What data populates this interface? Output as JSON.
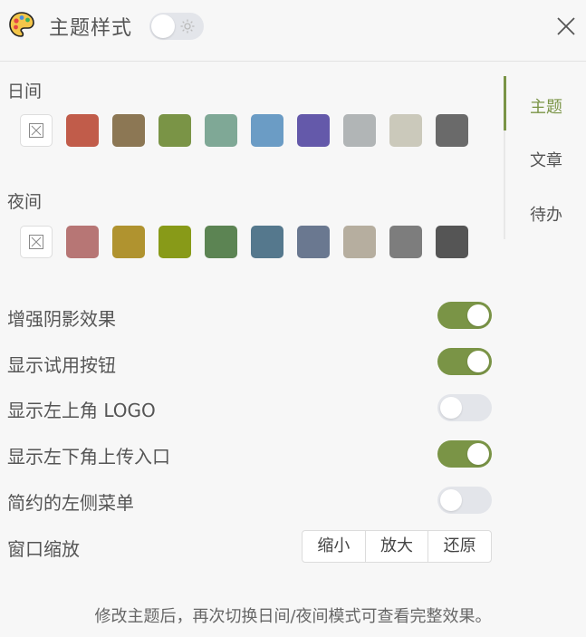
{
  "header": {
    "title": "主题样式",
    "toggle_on": false
  },
  "day": {
    "label": "日间",
    "colors": [
      "#c15c4a",
      "#8c7754",
      "#7a9446",
      "#7fa896",
      "#6b9cc5",
      "#6459aa",
      "#b1b5b6",
      "#cbc9bb",
      "#6a6a6a"
    ]
  },
  "night": {
    "label": "夜间",
    "colors": [
      "#b77675",
      "#b0932f",
      "#889a18",
      "#5c8453",
      "#55788d",
      "#6a7890",
      "#b6ae9f",
      "#7d7d7d",
      "#555555"
    ]
  },
  "side_nav": {
    "items": [
      {
        "label": "主题",
        "active": true
      },
      {
        "label": "文章",
        "active": false
      },
      {
        "label": "待办",
        "active": false
      }
    ]
  },
  "settings": [
    {
      "label": "增强阴影效果",
      "on": true
    },
    {
      "label": "显示试用按钮",
      "on": true
    },
    {
      "label": "显示左上角 LOGO",
      "on": false
    },
    {
      "label": "显示左下角上传入口",
      "on": true
    },
    {
      "label": "简约的左侧菜单",
      "on": false
    }
  ],
  "zoom": {
    "label": "窗口缩放",
    "buttons": [
      "缩小",
      "放大",
      "还原"
    ]
  },
  "footer": "修改主题后，再次切换日间/夜间模式可查看完整效果。",
  "accent_color": "#7a9446"
}
